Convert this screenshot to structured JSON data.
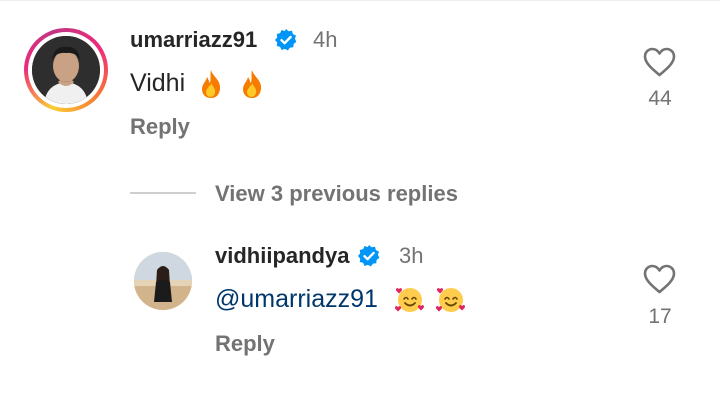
{
  "comments": [
    {
      "username": "umarriazz91",
      "time": "4h",
      "text": "Vidhi",
      "emojis": [
        "fire-emoji",
        "fire-emoji"
      ],
      "reply_label": "Reply",
      "likes": "44",
      "has_story_ring": true
    },
    {
      "username": "vidhiipandya",
      "time": "3h",
      "mention": "@umarriazz91",
      "emojis": [
        "smiling-face-with-hearts-emoji",
        "smiling-face-with-hearts-emoji"
      ],
      "reply_label": "Reply",
      "likes": "17",
      "has_story_ring": false
    }
  ],
  "view_previous": "View 3 previous replies",
  "colors": {
    "verified": "#0095f6",
    "mention": "#00376b",
    "secondary_text": "#737373",
    "primary_text": "#262626"
  }
}
